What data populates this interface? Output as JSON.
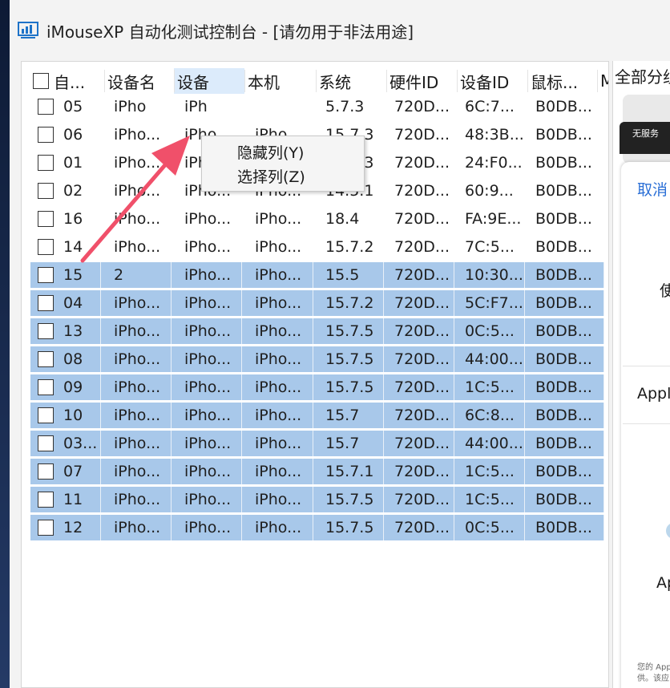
{
  "window": {
    "title": "iMouseXP 自动化测试控制台 - [请勿用于非法用途]"
  },
  "table": {
    "columns": [
      "自...",
      "设备名",
      "设备",
      "本机",
      "系统",
      "硬件ID",
      "设备ID",
      "鼠标...",
      "M"
    ],
    "rows": [
      {
        "id": "05",
        "name": "iPho",
        "dev": "iPh",
        "model": "",
        "sys": "5.7.3",
        "hw": "720D...",
        "devid": "6C:7...",
        "mouse": "B0DB...",
        "selected": false
      },
      {
        "id": "06",
        "name": "iPho...",
        "dev": "iPho...",
        "model": "iPho...",
        "sys": "15.7.3",
        "hw": "720D...",
        "devid": "48:3B...",
        "mouse": "B0DB...",
        "selected": false
      },
      {
        "id": "01",
        "name": "iPho...",
        "dev": "iPho...",
        "model": "iPho...",
        "sys": "15.7.3",
        "hw": "720D...",
        "devid": "24:F0...",
        "mouse": "B0DB...",
        "selected": false
      },
      {
        "id": "02",
        "name": "iPho...",
        "dev": "iPho...",
        "model": "iPho...",
        "sys": "14.5.1",
        "hw": "720D...",
        "devid": "60:9...",
        "mouse": "B0DB...",
        "selected": false
      },
      {
        "id": "16",
        "name": "iPho...",
        "dev": "iPho...",
        "model": "iPho...",
        "sys": "18.4",
        "hw": "720D...",
        "devid": "FA:9E...",
        "mouse": "B0DB...",
        "selected": false
      },
      {
        "id": "14",
        "name": "iPho...",
        "dev": "iPho...",
        "model": "iPho...",
        "sys": "15.7.2",
        "hw": "720D...",
        "devid": "7C:5...",
        "mouse": "B0DB...",
        "selected": false
      },
      {
        "id": "15",
        "name": "2",
        "dev": "iPho...",
        "model": "iPho...",
        "sys": "15.5",
        "hw": "720D...",
        "devid": "10:30...",
        "mouse": "B0DB...",
        "selected": true
      },
      {
        "id": "04",
        "name": "iPho...",
        "dev": "iPho...",
        "model": "iPho...",
        "sys": "15.7.2",
        "hw": "720D...",
        "devid": "5C:F7...",
        "mouse": "B0DB...",
        "selected": true
      },
      {
        "id": "13",
        "name": "iPho...",
        "dev": "iPho...",
        "model": "iPho...",
        "sys": "15.7.5",
        "hw": "720D...",
        "devid": "0C:5...",
        "mouse": "B0DB...",
        "selected": true
      },
      {
        "id": "08",
        "name": "iPho...",
        "dev": "iPho...",
        "model": "iPho...",
        "sys": "15.7.5",
        "hw": "720D...",
        "devid": "44:00...",
        "mouse": "B0DB...",
        "selected": true
      },
      {
        "id": "09",
        "name": "iPho...",
        "dev": "iPho...",
        "model": "iPho...",
        "sys": "15.7.5",
        "hw": "720D...",
        "devid": "1C:5...",
        "mouse": "B0DB...",
        "selected": true
      },
      {
        "id": "10",
        "name": "iPho...",
        "dev": "iPho...",
        "model": "iPho...",
        "sys": "15.7",
        "hw": "720D...",
        "devid": "6C:8...",
        "mouse": "B0DB...",
        "selected": true
      },
      {
        "id": "03...",
        "name": "iPho...",
        "dev": "iPho...",
        "model": "iPho...",
        "sys": "15.7",
        "hw": "720D...",
        "devid": "44:00...",
        "mouse": "B0DB...",
        "selected": true
      },
      {
        "id": "07",
        "name": "iPho...",
        "dev": "iPho...",
        "model": "iPho...",
        "sys": "15.7.1",
        "hw": "720D...",
        "devid": "1C:5...",
        "mouse": "B0DB...",
        "selected": true
      },
      {
        "id": "11",
        "name": "iPho...",
        "dev": "iPho...",
        "model": "iPho...",
        "sys": "15.7.5",
        "hw": "720D...",
        "devid": "1C:5...",
        "mouse": "B0DB...",
        "selected": true
      },
      {
        "id": "12",
        "name": "iPho...",
        "dev": "iPho...",
        "model": "iPho...",
        "sys": "15.7.5",
        "hw": "720D...",
        "devid": "0C:5...",
        "mouse": "B0DB...",
        "selected": true
      }
    ]
  },
  "context_menu": {
    "items": [
      "隐藏列(Y)",
      "选择列(Z)"
    ]
  },
  "right_panel": {
    "title": "全部分组",
    "status_text": "无服务",
    "cancel_label": "取消",
    "use_text": "使月",
    "apple_text": "Apple",
    "app_text": "App",
    "small_text_1": "您的 App",
    "small_text_2": "供。该应"
  },
  "colors": {
    "selected_row": "#a8c8ea",
    "header_hover": "#dcebfb",
    "annotation_arrow": "#f0506a",
    "cancel_link": "#2b6fd6"
  }
}
